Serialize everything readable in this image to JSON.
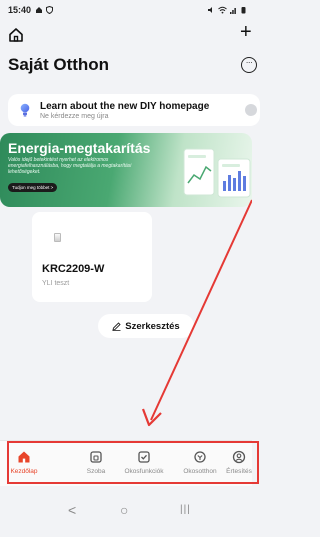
{
  "status_bar": {
    "time": "15:40",
    "left_icons": [
      "home-status-icon",
      "shield-icon"
    ],
    "right_icons": [
      "mute-icon",
      "wifi-icon",
      "signal-icon",
      "battery-icon"
    ]
  },
  "header": {
    "title": "Saját Otthon",
    "plus_label": "+",
    "more_label": "···"
  },
  "diy_banner": {
    "title": "Learn about the new DIY homepage",
    "subtitle": "Ne kérdezze meg újra"
  },
  "promo": {
    "title": "Energia-megtakarítás",
    "description": "Valós idejű betekintést nyerhet az elektromos energiafelhasználásba, hogy megtalálja a megtakarítási lehetőségeket.",
    "button_label": "Tudjon meg többet >"
  },
  "device": {
    "name": "KRC2209-W",
    "room": "YLI teszt"
  },
  "edit": {
    "label": "Szerkesztés"
  },
  "nav": {
    "items": [
      {
        "label": "Kezdőlap",
        "icon": "home-icon",
        "active": true
      },
      {
        "label": "Szoba",
        "icon": "room-icon",
        "active": false
      },
      {
        "label": "Okosfunkciók",
        "icon": "smart-check-icon",
        "active": false
      },
      {
        "label": "Okosotthon",
        "icon": "smart-home-icon",
        "active": false
      },
      {
        "label": "Értesítés",
        "icon": "profile-icon",
        "active": false
      }
    ]
  },
  "system_nav": {
    "back": "<",
    "home": "○",
    "recents": "|||"
  },
  "colors": {
    "accent": "#e8452a",
    "annotation": "#e53935",
    "promo_green": "#2e8a5a"
  }
}
